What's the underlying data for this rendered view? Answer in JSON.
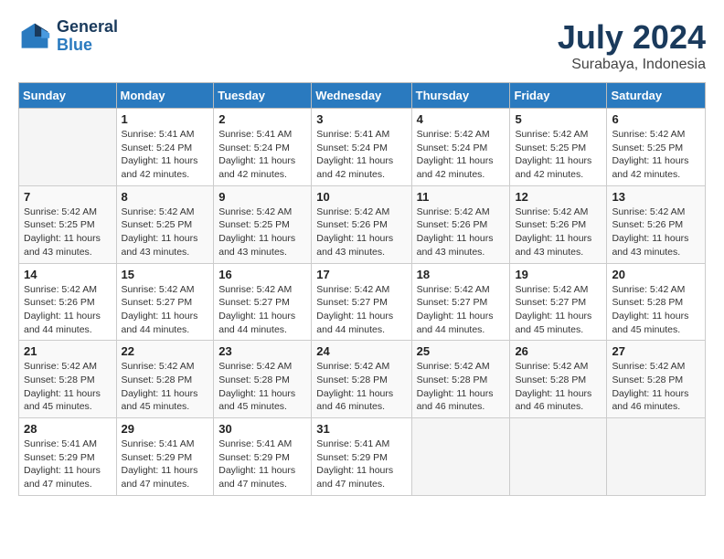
{
  "header": {
    "logo_line1": "General",
    "logo_line2": "Blue",
    "month": "July 2024",
    "location": "Surabaya, Indonesia"
  },
  "days_of_week": [
    "Sunday",
    "Monday",
    "Tuesday",
    "Wednesday",
    "Thursday",
    "Friday",
    "Saturday"
  ],
  "weeks": [
    [
      {
        "day": "",
        "info": ""
      },
      {
        "day": "1",
        "info": "Sunrise: 5:41 AM\nSunset: 5:24 PM\nDaylight: 11 hours\nand 42 minutes."
      },
      {
        "day": "2",
        "info": "Sunrise: 5:41 AM\nSunset: 5:24 PM\nDaylight: 11 hours\nand 42 minutes."
      },
      {
        "day": "3",
        "info": "Sunrise: 5:41 AM\nSunset: 5:24 PM\nDaylight: 11 hours\nand 42 minutes."
      },
      {
        "day": "4",
        "info": "Sunrise: 5:42 AM\nSunset: 5:24 PM\nDaylight: 11 hours\nand 42 minutes."
      },
      {
        "day": "5",
        "info": "Sunrise: 5:42 AM\nSunset: 5:25 PM\nDaylight: 11 hours\nand 42 minutes."
      },
      {
        "day": "6",
        "info": "Sunrise: 5:42 AM\nSunset: 5:25 PM\nDaylight: 11 hours\nand 42 minutes."
      }
    ],
    [
      {
        "day": "7",
        "info": "Sunrise: 5:42 AM\nSunset: 5:25 PM\nDaylight: 11 hours\nand 43 minutes."
      },
      {
        "day": "8",
        "info": "Sunrise: 5:42 AM\nSunset: 5:25 PM\nDaylight: 11 hours\nand 43 minutes."
      },
      {
        "day": "9",
        "info": "Sunrise: 5:42 AM\nSunset: 5:25 PM\nDaylight: 11 hours\nand 43 minutes."
      },
      {
        "day": "10",
        "info": "Sunrise: 5:42 AM\nSunset: 5:26 PM\nDaylight: 11 hours\nand 43 minutes."
      },
      {
        "day": "11",
        "info": "Sunrise: 5:42 AM\nSunset: 5:26 PM\nDaylight: 11 hours\nand 43 minutes."
      },
      {
        "day": "12",
        "info": "Sunrise: 5:42 AM\nSunset: 5:26 PM\nDaylight: 11 hours\nand 43 minutes."
      },
      {
        "day": "13",
        "info": "Sunrise: 5:42 AM\nSunset: 5:26 PM\nDaylight: 11 hours\nand 43 minutes."
      }
    ],
    [
      {
        "day": "14",
        "info": "Sunrise: 5:42 AM\nSunset: 5:26 PM\nDaylight: 11 hours\nand 44 minutes."
      },
      {
        "day": "15",
        "info": "Sunrise: 5:42 AM\nSunset: 5:27 PM\nDaylight: 11 hours\nand 44 minutes."
      },
      {
        "day": "16",
        "info": "Sunrise: 5:42 AM\nSunset: 5:27 PM\nDaylight: 11 hours\nand 44 minutes."
      },
      {
        "day": "17",
        "info": "Sunrise: 5:42 AM\nSunset: 5:27 PM\nDaylight: 11 hours\nand 44 minutes."
      },
      {
        "day": "18",
        "info": "Sunrise: 5:42 AM\nSunset: 5:27 PM\nDaylight: 11 hours\nand 44 minutes."
      },
      {
        "day": "19",
        "info": "Sunrise: 5:42 AM\nSunset: 5:27 PM\nDaylight: 11 hours\nand 45 minutes."
      },
      {
        "day": "20",
        "info": "Sunrise: 5:42 AM\nSunset: 5:28 PM\nDaylight: 11 hours\nand 45 minutes."
      }
    ],
    [
      {
        "day": "21",
        "info": "Sunrise: 5:42 AM\nSunset: 5:28 PM\nDaylight: 11 hours\nand 45 minutes."
      },
      {
        "day": "22",
        "info": "Sunrise: 5:42 AM\nSunset: 5:28 PM\nDaylight: 11 hours\nand 45 minutes."
      },
      {
        "day": "23",
        "info": "Sunrise: 5:42 AM\nSunset: 5:28 PM\nDaylight: 11 hours\nand 45 minutes."
      },
      {
        "day": "24",
        "info": "Sunrise: 5:42 AM\nSunset: 5:28 PM\nDaylight: 11 hours\nand 46 minutes."
      },
      {
        "day": "25",
        "info": "Sunrise: 5:42 AM\nSunset: 5:28 PM\nDaylight: 11 hours\nand 46 minutes."
      },
      {
        "day": "26",
        "info": "Sunrise: 5:42 AM\nSunset: 5:28 PM\nDaylight: 11 hours\nand 46 minutes."
      },
      {
        "day": "27",
        "info": "Sunrise: 5:42 AM\nSunset: 5:28 PM\nDaylight: 11 hours\nand 46 minutes."
      }
    ],
    [
      {
        "day": "28",
        "info": "Sunrise: 5:41 AM\nSunset: 5:29 PM\nDaylight: 11 hours\nand 47 minutes."
      },
      {
        "day": "29",
        "info": "Sunrise: 5:41 AM\nSunset: 5:29 PM\nDaylight: 11 hours\nand 47 minutes."
      },
      {
        "day": "30",
        "info": "Sunrise: 5:41 AM\nSunset: 5:29 PM\nDaylight: 11 hours\nand 47 minutes."
      },
      {
        "day": "31",
        "info": "Sunrise: 5:41 AM\nSunset: 5:29 PM\nDaylight: 11 hours\nand 47 minutes."
      },
      {
        "day": "",
        "info": ""
      },
      {
        "day": "",
        "info": ""
      },
      {
        "day": "",
        "info": ""
      }
    ]
  ]
}
